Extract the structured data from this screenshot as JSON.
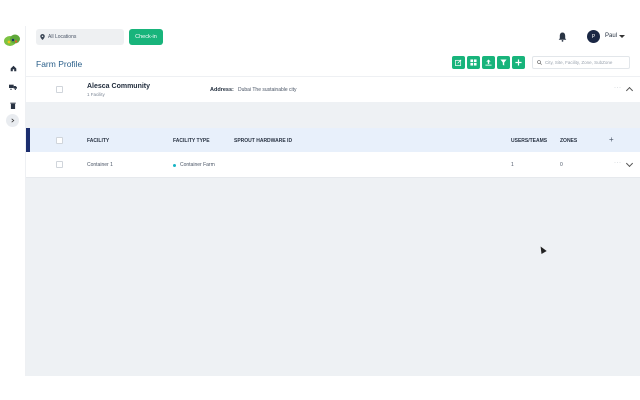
{
  "header": {
    "location_label": "All Locations",
    "checkin_label": "Check-in",
    "user_initial": "P",
    "user_name": "Paul"
  },
  "page": {
    "title": "Farm Profile",
    "search_placeholder": "City, Site, Facility, Zone, SubZone"
  },
  "community": {
    "name": "Alesca Community",
    "facility_count": "1 Facility",
    "address_label": "Address:",
    "address_value": "Dubai The sustainable city"
  },
  "table": {
    "columns": {
      "facility": "FACILITY",
      "facility_type": "FACILITY TYPE",
      "sprout_id": "SPROUT HARDWARE ID",
      "users": "USERS/TEAMS",
      "zones": "ZONES"
    },
    "add_symbol": "+",
    "rows": [
      {
        "facility": "Container 1",
        "facility_type": "Container Farm",
        "sprout_id": "",
        "users": "1",
        "zones": "0"
      }
    ]
  },
  "icons": {
    "sidebar": [
      "home-icon",
      "truck-icon",
      "trash-icon",
      "chevron-right-icon"
    ],
    "toolbar": [
      "edit-icon",
      "grid-icon",
      "upload-icon",
      "filter-icon",
      "plus-icon"
    ]
  },
  "colors": {
    "accent_green": "#18b47b",
    "navy": "#1c2e6e",
    "title_blue": "#2a5f8a"
  }
}
